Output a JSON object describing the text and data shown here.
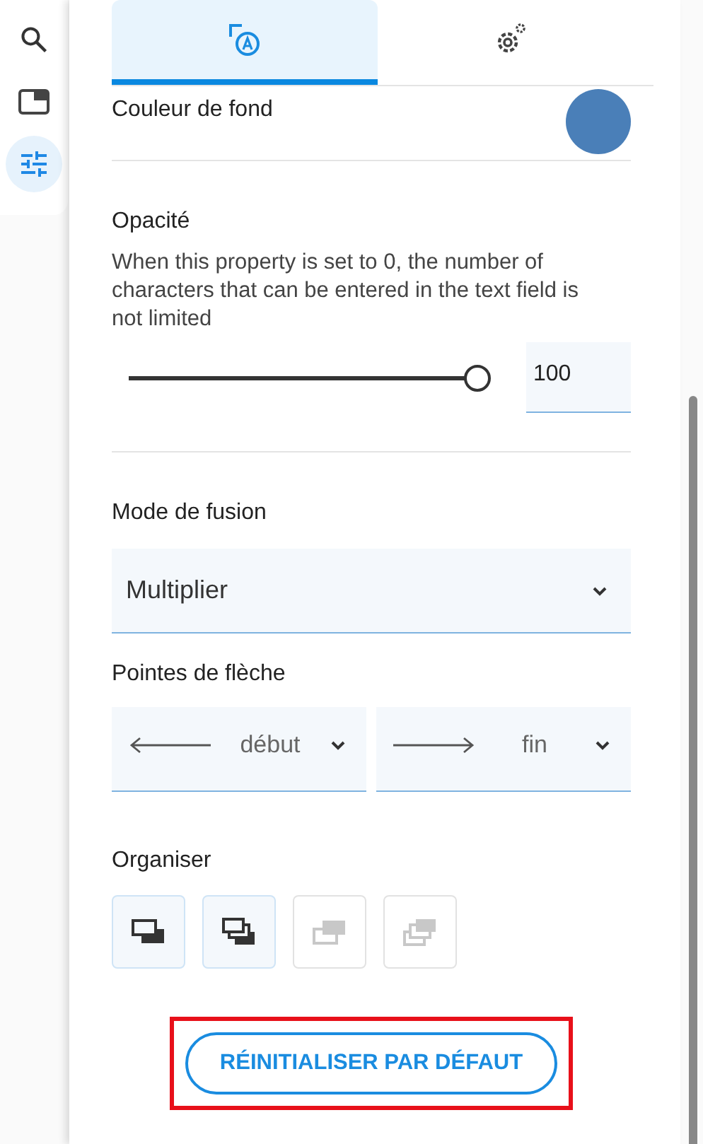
{
  "rail": [
    {
      "kind": "search",
      "selected": false
    },
    {
      "kind": "window",
      "selected": false
    },
    {
      "kind": "sliders",
      "selected": true
    }
  ],
  "tabs": [
    {
      "kind": "style",
      "selected": true
    },
    {
      "kind": "settings",
      "selected": false
    }
  ],
  "background": {
    "label": "Couleur de fond",
    "color": "#4a7fb8"
  },
  "opacity": {
    "label": "Opacité",
    "hint": "When this property is set to 0, the number of characters that can be entered in the text field is not limited",
    "level": 1,
    "value": "100"
  },
  "blend": {
    "label": "Mode de fusion",
    "value": "Multiplier"
  },
  "arrowheads": {
    "label": "Pointes de flèche",
    "start": "début",
    "end": "fin"
  },
  "arrange": {
    "label": "Organiser",
    "buttons": [
      {
        "kind": "forward",
        "disabled": false
      },
      {
        "kind": "front",
        "disabled": false
      },
      {
        "kind": "backward",
        "disabled": true
      },
      {
        "kind": "back",
        "disabled": true
      }
    ]
  },
  "reset": {
    "label": "RÉINITIALISER PAR DÉFAUT",
    "highlighted": true
  }
}
